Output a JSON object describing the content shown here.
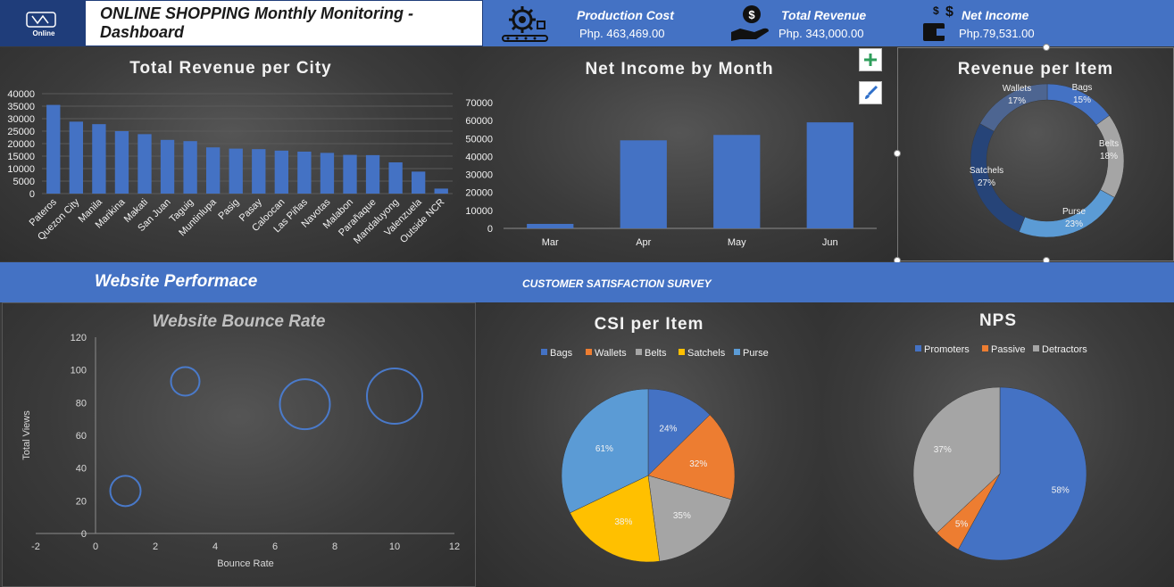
{
  "header": {
    "logo_text": "Online",
    "title": "ONLINE SHOPPING Monthly Monitoring  - Dashboard"
  },
  "kpis": [
    {
      "label": "Production Cost",
      "value": "Php. 463,469.00",
      "icon": "factory-gear-icon"
    },
    {
      "label": "Total Revenue",
      "value": "Php. 343,000.00",
      "icon": "hand-coin-icon"
    },
    {
      "label": "Net Income",
      "value": "Php.79,531.00",
      "icon": "wallet-dollar-icon"
    }
  ],
  "band": {
    "left_title": "Website Performace",
    "right_title": "CUSTOMER SATISFACTION SURVEY"
  },
  "colors": {
    "bar": "#4472c4",
    "band": "#4472c4",
    "bags": "#4472c4",
    "wallets": "#ed7d31",
    "belts": "#a5a5a5",
    "satchels": "#ffc000",
    "purse": "#5b9bd5"
  },
  "chart_data": [
    {
      "type": "bar",
      "title": "Total Revenue per City",
      "categories": [
        "Pateros",
        "Quezon City",
        "Manila",
        "Marikina",
        "Makati",
        "San Juan",
        "Taguig",
        "Muntinlupa",
        "Pasig",
        "Pasay",
        "Caloocan",
        "Las Piñas",
        "Navotas",
        "Malabon",
        "Parañaque",
        "Mandaluyong",
        "Valenzuela",
        "Outside NCR"
      ],
      "values": [
        35500,
        28800,
        27800,
        25000,
        23800,
        21500,
        21000,
        18500,
        18000,
        17800,
        17200,
        16800,
        16300,
        15500,
        15400,
        12500,
        8800,
        2000
      ],
      "ylim": [
        0,
        40000
      ],
      "yticks": [
        "0",
        "5000",
        "10000",
        "15000",
        "20000",
        "25000",
        "30000",
        "35000",
        "40000"
      ],
      "grid": true
    },
    {
      "type": "bar",
      "title": "Net Income by Month",
      "categories": [
        "Mar",
        "Apr",
        "May",
        "Jun"
      ],
      "values": [
        2500,
        49000,
        52000,
        59000
      ],
      "ylim": [
        0,
        70000
      ],
      "yticks": [
        "0",
        "10000",
        "20000",
        "30000",
        "40000",
        "50000",
        "60000",
        "70000"
      ],
      "grid": false
    },
    {
      "type": "pie",
      "title": "Revenue per Item",
      "donut": true,
      "slices": [
        {
          "label": "Bags",
          "pct": "15%",
          "value": 15
        },
        {
          "label": "Belts",
          "pct": "18%",
          "value": 18
        },
        {
          "label": "Purse",
          "pct": "23%",
          "value": 23
        },
        {
          "label": "Satchels",
          "pct": "27%",
          "value": 27
        },
        {
          "label": "Wallets",
          "pct": "17%",
          "value": 17
        }
      ]
    },
    {
      "type": "scatter",
      "title": "Website Bounce Rate",
      "xlabel": "Bounce Rate",
      "ylabel": "Total Views",
      "xlim": [
        -2,
        12
      ],
      "ylim": [
        0,
        120
      ],
      "xticks": [
        "-2",
        "0",
        "2",
        "4",
        "6",
        "8",
        "10",
        "12"
      ],
      "yticks": [
        "0",
        "20",
        "40",
        "60",
        "80",
        "100",
        "120"
      ],
      "points": [
        {
          "x": 1,
          "y": 26,
          "size": 17
        },
        {
          "x": 3,
          "y": 93,
          "size": 16
        },
        {
          "x": 7,
          "y": 79,
          "size": 28
        },
        {
          "x": 10,
          "y": 84,
          "size": 31
        }
      ]
    },
    {
      "type": "pie",
      "title": "CSI per Item",
      "legend": [
        "Bags",
        "Wallets",
        "Belts",
        "Satchels",
        "Purse"
      ],
      "slices": [
        {
          "label": "Bags",
          "pct": "24%",
          "value": 24
        },
        {
          "label": "Wallets",
          "pct": "32%",
          "value": 32
        },
        {
          "label": "Belts",
          "pct": "35%",
          "value": 35
        },
        {
          "label": "Satchels",
          "pct": "38%",
          "value": 38
        },
        {
          "label": "Purse",
          "pct": "61%",
          "value": 61
        }
      ]
    },
    {
      "type": "pie",
      "title": "NPS",
      "legend": [
        "Promoters",
        "Passive",
        "Detractors"
      ],
      "slices": [
        {
          "label": "Promoters",
          "pct": "58%",
          "value": 58
        },
        {
          "label": "Passive",
          "pct": "5%",
          "value": 5
        },
        {
          "label": "Detractors",
          "pct": "37%",
          "value": 37
        }
      ]
    }
  ]
}
